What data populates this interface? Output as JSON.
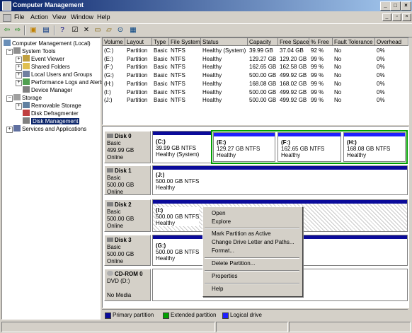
{
  "window": {
    "title": "Computer Management"
  },
  "menus": [
    "File",
    "Action",
    "View",
    "Window",
    "Help"
  ],
  "tree": {
    "root": "Computer Management (Local)",
    "system_tools": "System Tools",
    "event_viewer": "Event Viewer",
    "shared_folders": "Shared Folders",
    "local_users": "Local Users and Groups",
    "perf_logs": "Performance Logs and Alerts",
    "device_manager": "Device Manager",
    "storage": "Storage",
    "removable": "Removable Storage",
    "defrag": "Disk Defragmenter",
    "disk_mgmt": "Disk Management",
    "services": "Services and Applications"
  },
  "volumes": {
    "headers": [
      "Volume",
      "Layout",
      "Type",
      "File System",
      "Status",
      "Capacity",
      "Free Space",
      "% Free",
      "Fault Tolerance",
      "Overhead"
    ],
    "rows": [
      [
        "(C:)",
        "Partition",
        "Basic",
        "NTFS",
        "Healthy (System)",
        "39.99 GB",
        "37.04 GB",
        "92 %",
        "No",
        "0%"
      ],
      [
        "(E:)",
        "Partition",
        "Basic",
        "NTFS",
        "Healthy",
        "129.27 GB",
        "129.20 GB",
        "99 %",
        "No",
        "0%"
      ],
      [
        "(F:)",
        "Partition",
        "Basic",
        "NTFS",
        "Healthy",
        "162.65 GB",
        "162.58 GB",
        "99 %",
        "No",
        "0%"
      ],
      [
        "(G:)",
        "Partition",
        "Basic",
        "NTFS",
        "Healthy",
        "500.00 GB",
        "499.92 GB",
        "99 %",
        "No",
        "0%"
      ],
      [
        "(H:)",
        "Partition",
        "Basic",
        "NTFS",
        "Healthy",
        "168.08 GB",
        "168.02 GB",
        "99 %",
        "No",
        "0%"
      ],
      [
        "(I:)",
        "Partition",
        "Basic",
        "NTFS",
        "Healthy",
        "500.00 GB",
        "499.92 GB",
        "99 %",
        "No",
        "0%"
      ],
      [
        "(J:)",
        "Partition",
        "Basic",
        "NTFS",
        "Healthy",
        "500.00 GB",
        "499.92 GB",
        "99 %",
        "No",
        "0%"
      ]
    ]
  },
  "disks": {
    "d0": {
      "name": "Disk 0",
      "type": "Basic",
      "size": "499.99 GB",
      "state": "Online",
      "c": {
        "name": "(C:)",
        "size": "39.99 GB NTFS",
        "status": "Healthy (System)"
      },
      "e": {
        "name": "(E:)",
        "size": "129.27 GB NTFS",
        "status": "Healthy"
      },
      "f": {
        "name": "(F:)",
        "size": "162.65 GB NTFS",
        "status": "Healthy"
      },
      "h": {
        "name": "(H:)",
        "size": "168.08 GB NTFS",
        "status": "Healthy"
      }
    },
    "d1": {
      "name": "Disk 1",
      "type": "Basic",
      "size": "500.00 GB",
      "state": "Online",
      "j": {
        "name": "(J:)",
        "size": "500.00 GB NTFS",
        "status": "Healthy"
      }
    },
    "d2": {
      "name": "Disk 2",
      "type": "Basic",
      "size": "500.00 GB",
      "state": "Online",
      "i": {
        "name": "(I:)",
        "size": "500.00 GB NTFS",
        "status": "Healthy"
      }
    },
    "d3": {
      "name": "Disk 3",
      "type": "Basic",
      "size": "500.00 GB",
      "state": "Online",
      "g": {
        "name": "(G:)",
        "size": "500.00 GB NTFS",
        "status": "Healthy"
      }
    },
    "cd": {
      "name": "CD-ROM 0",
      "drive": "DVD (D:)",
      "state": "No Media"
    }
  },
  "context_menu": {
    "open": "Open",
    "explore": "Explore",
    "mark_active": "Mark Partition as Active",
    "change_letter": "Change Drive Letter and Paths...",
    "format": "Format...",
    "delete": "Delete Partition...",
    "properties": "Properties",
    "help": "Help"
  },
  "legend": {
    "primary": "Primary partition",
    "extended": "Extended partition",
    "logical": "Logical drive"
  },
  "colors": {
    "primary": "#0a0a9a",
    "extended": "#00a000",
    "logical": "#1e1eff",
    "selection": "#0a246a"
  }
}
